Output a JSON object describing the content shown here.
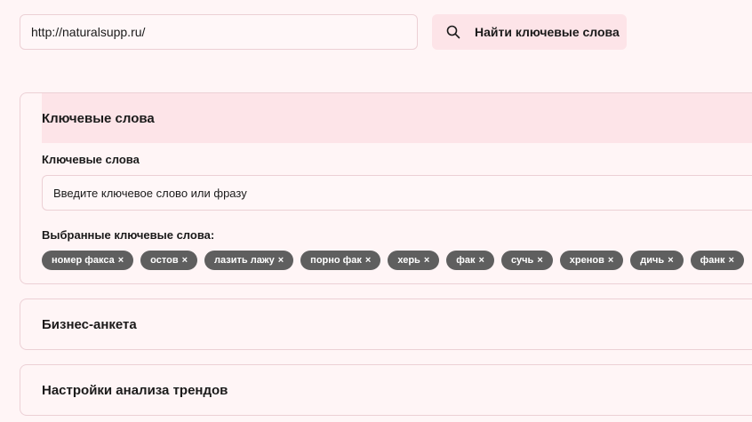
{
  "search": {
    "url_value": "http://naturalsupp.ru/",
    "button_label": "Найти ключевые слова"
  },
  "keywords_section": {
    "title": "Ключевые слова",
    "field_label": "Ключевые слова",
    "input_placeholder": "Введите ключевое слово или фразу",
    "selected_label": "Выбранные ключевые слова:",
    "remove_glyph": "×",
    "tags": [
      {
        "label": "номер факса"
      },
      {
        "label": "остов"
      },
      {
        "label": "лазить лажу"
      },
      {
        "label": "порно фак"
      },
      {
        "label": "херь"
      },
      {
        "label": "фак"
      },
      {
        "label": "сучь"
      },
      {
        "label": "хренов"
      },
      {
        "label": "дичь"
      },
      {
        "label": "фанк"
      }
    ]
  },
  "business_section": {
    "title": "Бизнес-анкета"
  },
  "trends_section": {
    "title": "Настройки анализа трендов"
  },
  "colors": {
    "background": "#fff5f6",
    "accent": "#fde4e8",
    "border": "#ecd0d5",
    "tag_bg": "#5f5f5f"
  },
  "icons": {
    "search_button_icon": "search-icon",
    "tag_remove_icon": "close-icon"
  }
}
